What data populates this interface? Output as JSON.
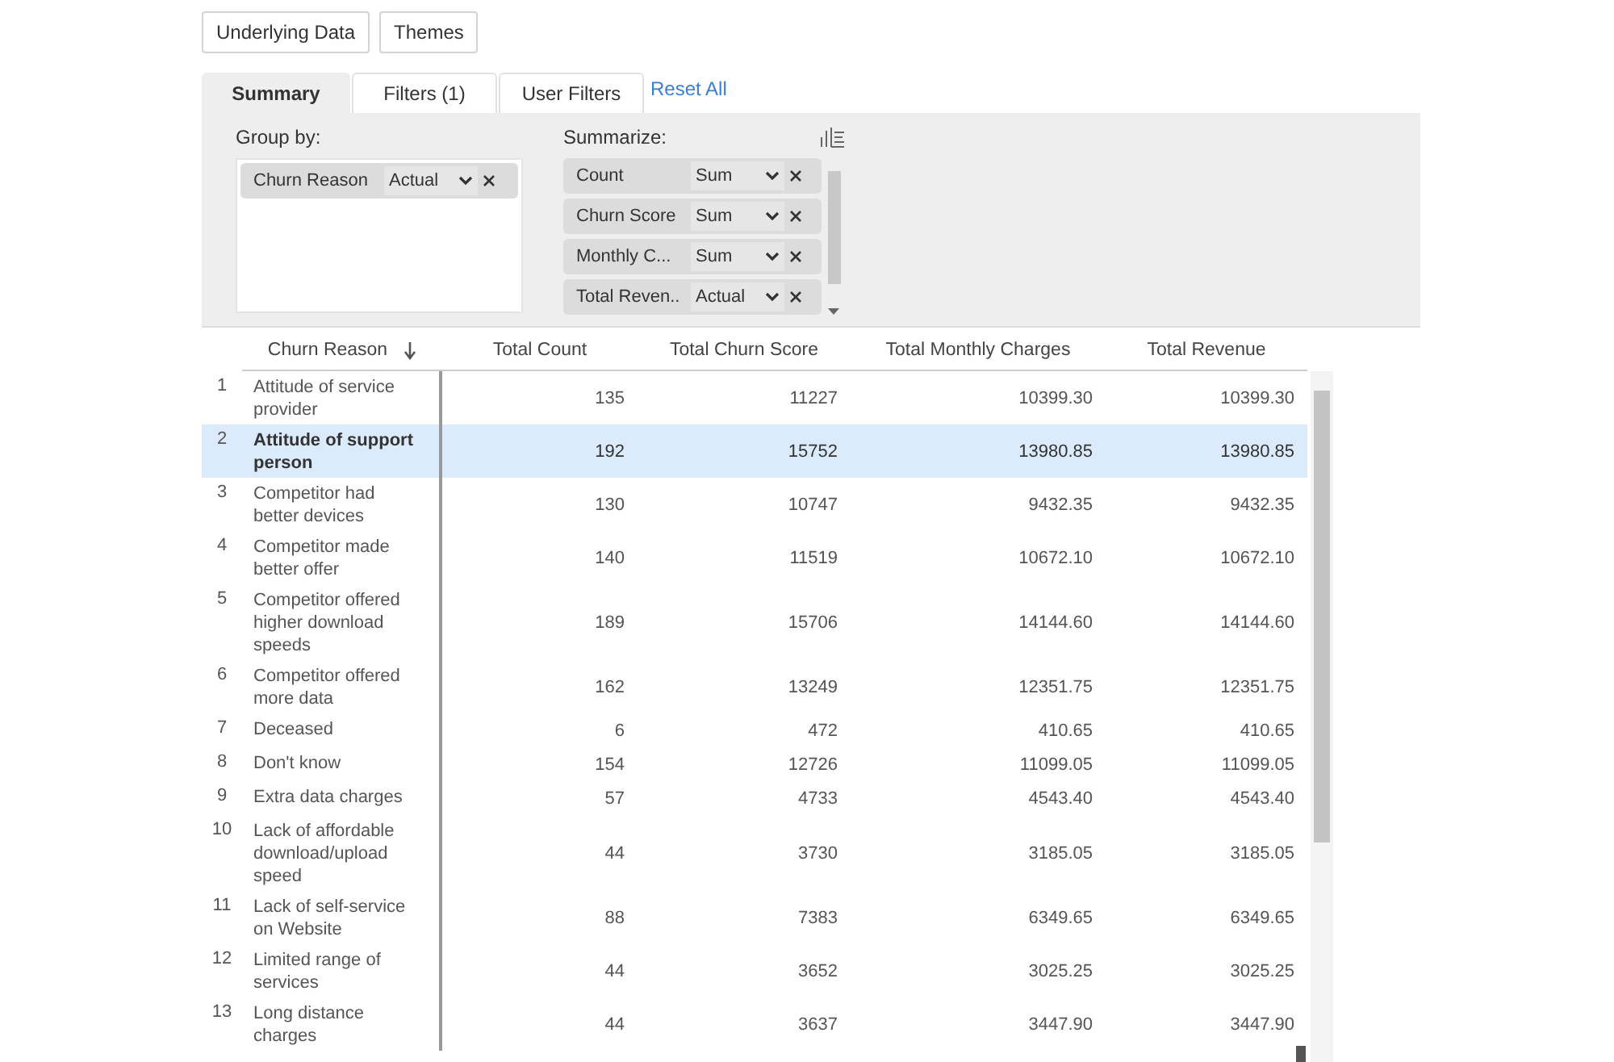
{
  "toolbar": [
    "Underlying Data",
    "Themes"
  ],
  "tabs": [
    {
      "label": "Summary",
      "selected": true
    },
    {
      "label": "Filters (1)",
      "selected": false
    },
    {
      "label": "User Filters",
      "selected": false
    }
  ],
  "reset_link": "Reset All",
  "group_by": {
    "label": "Group by:",
    "items": [
      {
        "field": "Churn Reason",
        "aggregation": "Actual"
      }
    ]
  },
  "summarize": {
    "label": "Summarize:",
    "items": [
      {
        "field": "Count",
        "aggregation": "Sum"
      },
      {
        "field": "Churn Score",
        "aggregation": "Sum"
      },
      {
        "field": "Monthly C...",
        "aggregation": "Sum"
      },
      {
        "field": "Total Reven..",
        "aggregation": "Actual"
      }
    ]
  },
  "table": {
    "columns": [
      {
        "label": "Churn Reason",
        "sorted": true
      },
      {
        "label": "Total Count",
        "sorted": false
      },
      {
        "label": "Total Churn Score",
        "sorted": false
      },
      {
        "label": "Total Monthly Charges",
        "sorted": false
      },
      {
        "label": "Total Revenue",
        "sorted": false
      }
    ],
    "rows": [
      {
        "index": "1",
        "selected": false,
        "cells": [
          "Attitude of service provider",
          "135",
          "11227",
          "10399.30",
          "10399.30"
        ]
      },
      {
        "index": "2",
        "selected": true,
        "cells": [
          "Attitude of support person",
          "192",
          "15752",
          "13980.85",
          "13980.85"
        ]
      },
      {
        "index": "3",
        "selected": false,
        "cells": [
          "Competitor had better devices",
          "130",
          "10747",
          "9432.35",
          "9432.35"
        ]
      },
      {
        "index": "4",
        "selected": false,
        "cells": [
          "Competitor made better offer",
          "140",
          "11519",
          "10672.10",
          "10672.10"
        ]
      },
      {
        "index": "5",
        "selected": false,
        "cells": [
          "Competitor offered higher download speeds",
          "189",
          "15706",
          "14144.60",
          "14144.60"
        ]
      },
      {
        "index": "6",
        "selected": false,
        "cells": [
          "Competitor offered more data",
          "162",
          "13249",
          "12351.75",
          "12351.75"
        ]
      },
      {
        "index": "7",
        "selected": false,
        "cells": [
          "Deceased",
          "6",
          "472",
          "410.65",
          "410.65"
        ]
      },
      {
        "index": "8",
        "selected": false,
        "cells": [
          "Don't know",
          "154",
          "12726",
          "11099.05",
          "11099.05"
        ]
      },
      {
        "index": "9",
        "selected": false,
        "cells": [
          "Extra data charges",
          "57",
          "4733",
          "4543.40",
          "4543.40"
        ]
      },
      {
        "index": "10",
        "selected": false,
        "cells": [
          "Lack of affordable download/upload speed",
          "44",
          "3730",
          "3185.05",
          "3185.05"
        ]
      },
      {
        "index": "11",
        "selected": false,
        "cells": [
          "Lack of self-service on Website",
          "88",
          "7383",
          "6349.65",
          "6349.65"
        ]
      },
      {
        "index": "12",
        "selected": false,
        "cells": [
          "Limited range of services",
          "44",
          "3652",
          "3025.25",
          "3025.25"
        ]
      },
      {
        "index": "13",
        "selected": false,
        "cells": [
          "Long distance charges",
          "44",
          "3637",
          "3447.90",
          "3447.90"
        ]
      }
    ]
  }
}
